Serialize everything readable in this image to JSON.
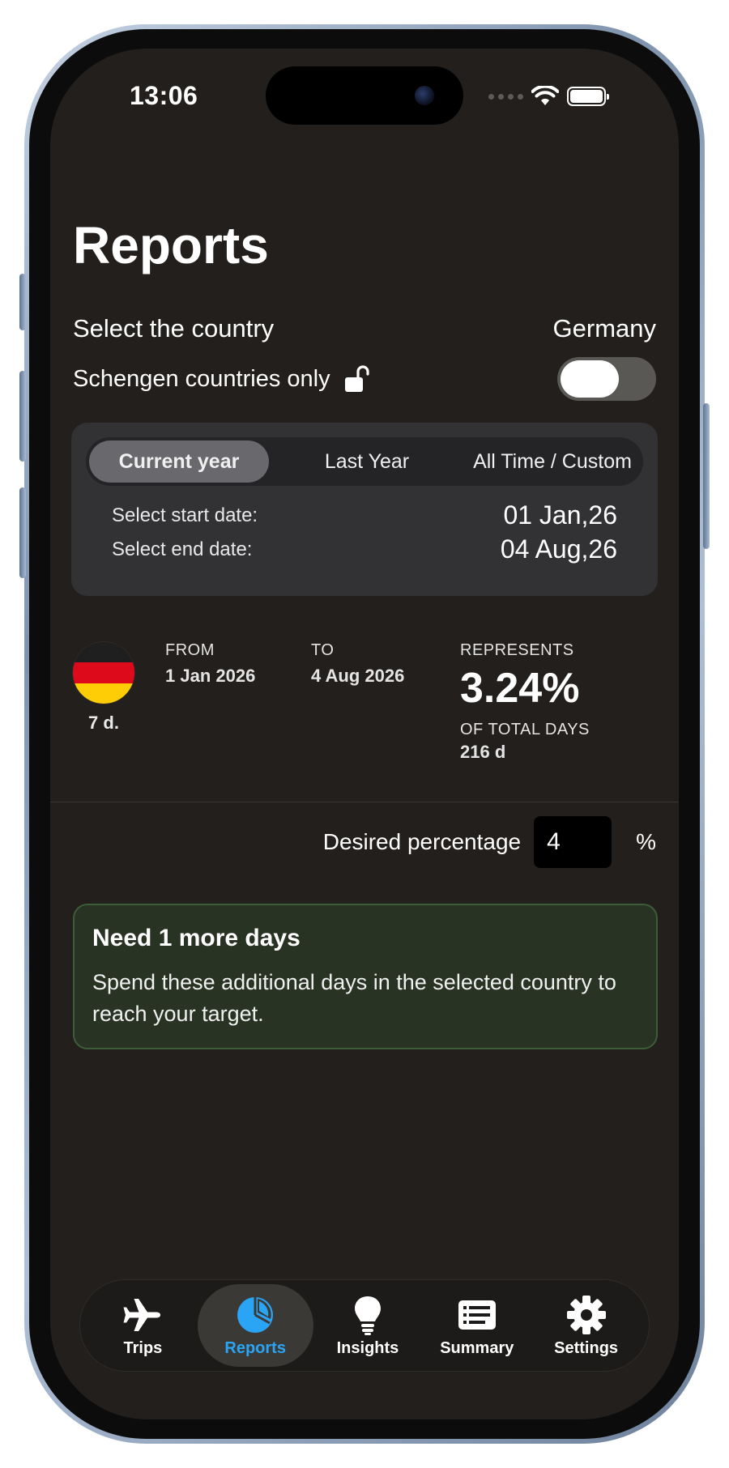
{
  "status_bar": {
    "time": "13:06"
  },
  "header": {
    "title": "Reports"
  },
  "country": {
    "label": "Select the country",
    "value": "Germany"
  },
  "schengen": {
    "label": "Schengen countries only",
    "enabled": false
  },
  "period": {
    "options": [
      "Current year",
      "Last Year",
      "All Time / Custom"
    ],
    "selected": "Current year",
    "start_label": "Select start date:",
    "start_value": "01 Jan,26",
    "end_label": "Select end date:",
    "end_value": "04 Aug,26"
  },
  "summary": {
    "days": "7 d.",
    "from_label": "FROM",
    "from_value": "1 Jan 2026",
    "to_label": "TO",
    "to_value": "4 Aug 2026",
    "represents_label": "REPRESENTS",
    "percent": "3.24%",
    "total_label": "OF TOTAL DAYS",
    "total_value": "216 d",
    "flag_colors": [
      "#1f1f1f",
      "#dd0a1c",
      "#ffcd05"
    ]
  },
  "desired": {
    "label": "Desired percentage",
    "value": "4",
    "unit": "%"
  },
  "need": {
    "title": "Need 1 more days",
    "text": "Spend these additional days in the selected country to reach your target."
  },
  "tabs": [
    {
      "label": "Trips",
      "icon": "airplane-icon"
    },
    {
      "label": "Reports",
      "icon": "pie-chart-icon",
      "active": true
    },
    {
      "label": "Insights",
      "icon": "lightbulb-icon"
    },
    {
      "label": "Summary",
      "icon": "list-icon"
    },
    {
      "label": "Settings",
      "icon": "gear-icon"
    }
  ],
  "colors": {
    "background": "#221f1c",
    "accent": "#2aa4f4",
    "success_bg": "#293323",
    "success_border": "#3d5d39"
  }
}
